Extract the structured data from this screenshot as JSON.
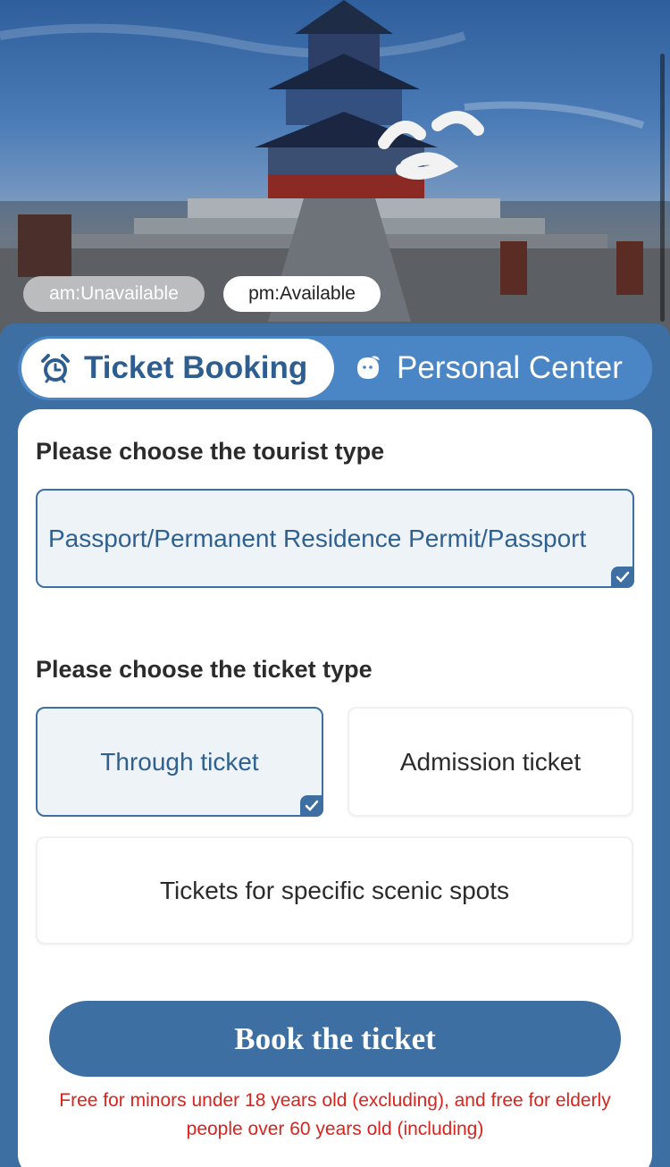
{
  "hero": {
    "am_status": "am:Unavailable",
    "pm_status": "pm:Available"
  },
  "tabs": [
    {
      "label": "Ticket Booking",
      "icon": "alarm-clock-icon",
      "active": true
    },
    {
      "label": "Personal Center",
      "icon": "face-icon",
      "active": false
    }
  ],
  "form": {
    "tourist_section_title": "Please choose the tourist type",
    "tourist_options": [
      {
        "label": "Passport/Permanent Residence Permit/Passport",
        "selected": true
      }
    ],
    "ticket_section_title": "Please choose the ticket type",
    "ticket_options": [
      {
        "label": "Through ticket",
        "selected": true
      },
      {
        "label": "Admission ticket",
        "selected": false
      },
      {
        "label": "Tickets for specific scenic spots",
        "selected": false
      }
    ],
    "book_button": "Book the ticket",
    "notice": "Free for minors under 18 years old (excluding), and free for elderly people over 60 years old (including)"
  },
  "colors": {
    "primary": "#3d6fa3",
    "tab_bar": "#4a86c6",
    "notice_red": "#d8241c",
    "selected_bg": "#eef3f8"
  }
}
